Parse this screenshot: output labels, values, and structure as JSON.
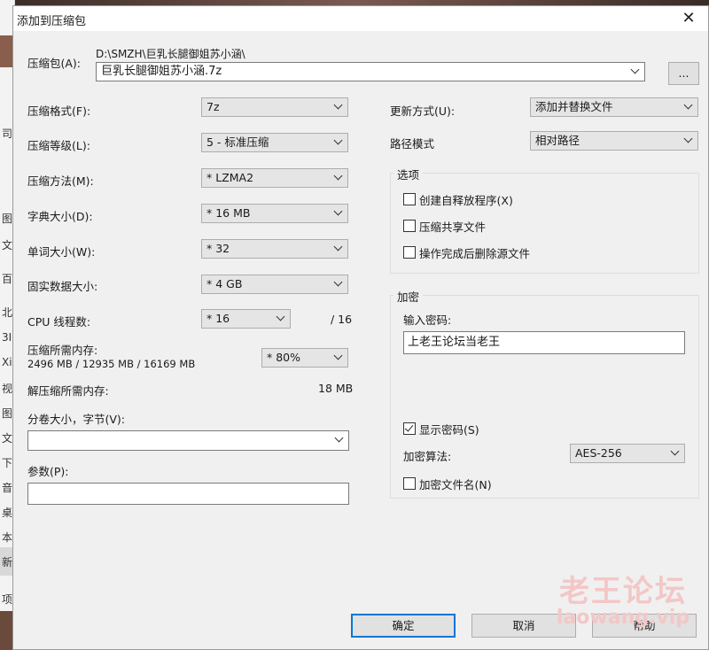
{
  "background_app": {
    "sidebar_glyphs": [
      "司",
      "图",
      "文",
      "百度",
      "北",
      "3I",
      "Xi",
      "视",
      "图",
      "文",
      "下",
      "音",
      "桌",
      "本",
      "新",
      "项目"
    ]
  },
  "dialog": {
    "title": "添加到压缩包",
    "close_glyph": "✕"
  },
  "archive": {
    "label": "压缩包(A):",
    "path_prefix": "D:\\SMZH\\巨乳长腿御姐苏小涵\\",
    "filename": "巨乳长腿御姐苏小涵.7z",
    "browse_label": "..."
  },
  "left_settings": [
    {
      "label": "压缩格式(F):",
      "value": "7z"
    },
    {
      "label": "压缩等级(L):",
      "value": "5 - 标准压缩"
    },
    {
      "label": "压缩方法(M):",
      "value": "* LZMA2"
    },
    {
      "label": "字典大小(D):",
      "value": "* 16 MB"
    },
    {
      "label": "单词大小(W):",
      "value": "* 32"
    },
    {
      "label": "固实数据大小:",
      "value": "* 4 GB"
    }
  ],
  "cpu": {
    "label": "CPU 线程数:",
    "value": "* 16",
    "max": "/ 16"
  },
  "memory": {
    "compress_label": "压缩所需内存:",
    "compress_stats": "2496 MB / 12935 MB / 16169 MB",
    "compress_percent": "* 80%",
    "decompress_label": "解压缩所需内存:",
    "decompress_value": "18 MB"
  },
  "split": {
    "label": "分卷大小，字节(V):",
    "value": ""
  },
  "params": {
    "label": "参数(P):",
    "value": ""
  },
  "update": {
    "label": "更新方式(U):",
    "value": "添加并替换文件"
  },
  "path_mode": {
    "label": "路径模式",
    "value": "相对路径"
  },
  "options": {
    "title": "选项",
    "items": [
      {
        "label": "创建自释放程序(X)",
        "checked": false
      },
      {
        "label": "压缩共享文件",
        "checked": false
      },
      {
        "label": "操作完成后删除源文件",
        "checked": false
      }
    ]
  },
  "encryption": {
    "title": "加密",
    "password_label": "输入密码:",
    "password_value": "上老王论坛当老王",
    "show_password_label": "显示密码(S)",
    "show_password_checked": true,
    "method_label": "加密算法:",
    "method_value": "AES-256",
    "encrypt_names_label": "加密文件名(N)",
    "encrypt_names_checked": false
  },
  "buttons": {
    "ok": "确定",
    "cancel": "取消",
    "help": "帮助"
  },
  "watermark": {
    "main": "老王论坛",
    "sub": "laowang.vip"
  }
}
